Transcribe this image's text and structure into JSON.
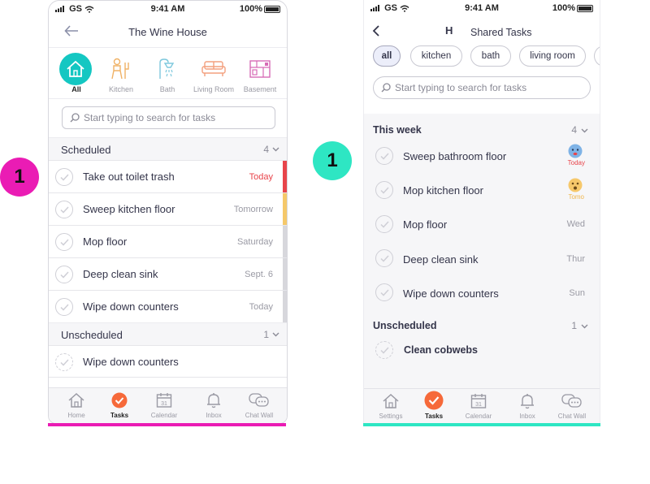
{
  "badges": {
    "left": "1",
    "right": "1"
  },
  "colors": {
    "magenta": "#ea1cb4",
    "mint": "#2ee6c3",
    "orange": "#f6693a",
    "red": "#e8444a",
    "yellow": "#f5c86a",
    "grey": "#d7d7dc"
  },
  "left_phone": {
    "status": {
      "carrier": "GS",
      "time": "9:41 AM",
      "battery": "100%"
    },
    "header": {
      "back_icon": "arrow-left-icon",
      "title": "The Wine House"
    },
    "rooms": [
      {
        "label": "All",
        "icon": "house-icon"
      },
      {
        "label": "Kitchen",
        "icon": "kitchen-icon"
      },
      {
        "label": "Bath",
        "icon": "shower-icon"
      },
      {
        "label": "Living Room",
        "icon": "sofa-icon"
      },
      {
        "label": "Basement",
        "icon": "basement-icon"
      }
    ],
    "search": {
      "placeholder": "Start typing to search for tasks"
    },
    "scheduled": {
      "label": "Scheduled",
      "count": "4"
    },
    "tasks": [
      {
        "label": "Take out toilet trash",
        "due": "Today",
        "flag": "red"
      },
      {
        "label": "Sweep kitchen floor",
        "due": "Tomorrow",
        "flag": "yellow"
      },
      {
        "label": "Mop floor",
        "due": "Saturday",
        "flag": "grey"
      },
      {
        "label": "Deep clean sink",
        "due": "Sept. 6",
        "flag": "grey"
      },
      {
        "label": "Wipe down counters",
        "due": "Today",
        "flag": "grey"
      }
    ],
    "unscheduled": {
      "label": "Unscheduled",
      "count": "1"
    },
    "unscheduled_tasks": [
      {
        "label": "Wipe down counters"
      }
    ],
    "tabs": [
      {
        "label": "Home",
        "icon": "home-icon"
      },
      {
        "label": "Tasks",
        "icon": "check-circle-icon"
      },
      {
        "label": "Calendar",
        "icon": "calendar-icon"
      },
      {
        "label": "Inbox",
        "icon": "bell-icon"
      },
      {
        "label": "Chat Wall",
        "icon": "chat-icon"
      }
    ]
  },
  "right_phone": {
    "status": {
      "carrier": "GS",
      "time": "9:41 AM",
      "battery": "100%"
    },
    "header": {
      "back_icon": "chevron-left-icon",
      "title_fragment": "H",
      "title": "Shared Tasks"
    },
    "chips": [
      "all",
      "kitchen",
      "bath",
      "living room"
    ],
    "search": {
      "placeholder": "Start typing to search for tasks"
    },
    "this_week": {
      "label": "This week",
      "count": "4"
    },
    "tasks": [
      {
        "label": "Sweep bathroom floor",
        "due": "Today",
        "emoji": "sad-face-icon"
      },
      {
        "label": "Mop kitchen floor",
        "due": "Tomo",
        "emoji": "surprised-face-icon"
      },
      {
        "label": "Mop floor",
        "due": "Wed"
      },
      {
        "label": "Deep clean sink",
        "due": "Thur"
      },
      {
        "label": "Wipe down counters",
        "due": "Sun"
      }
    ],
    "unscheduled": {
      "label": "Unscheduled",
      "count": "1"
    },
    "unscheduled_tasks": [
      {
        "label": "Clean cobwebs"
      }
    ],
    "tabs": [
      {
        "label": "Settings",
        "icon": "home-icon"
      },
      {
        "label": "Tasks",
        "icon": "check-circle-icon"
      },
      {
        "label": "Calendar",
        "icon": "calendar-icon"
      },
      {
        "label": "Inbox",
        "icon": "bell-icon"
      },
      {
        "label": "Chat Wall",
        "icon": "chat-icon"
      }
    ]
  }
}
